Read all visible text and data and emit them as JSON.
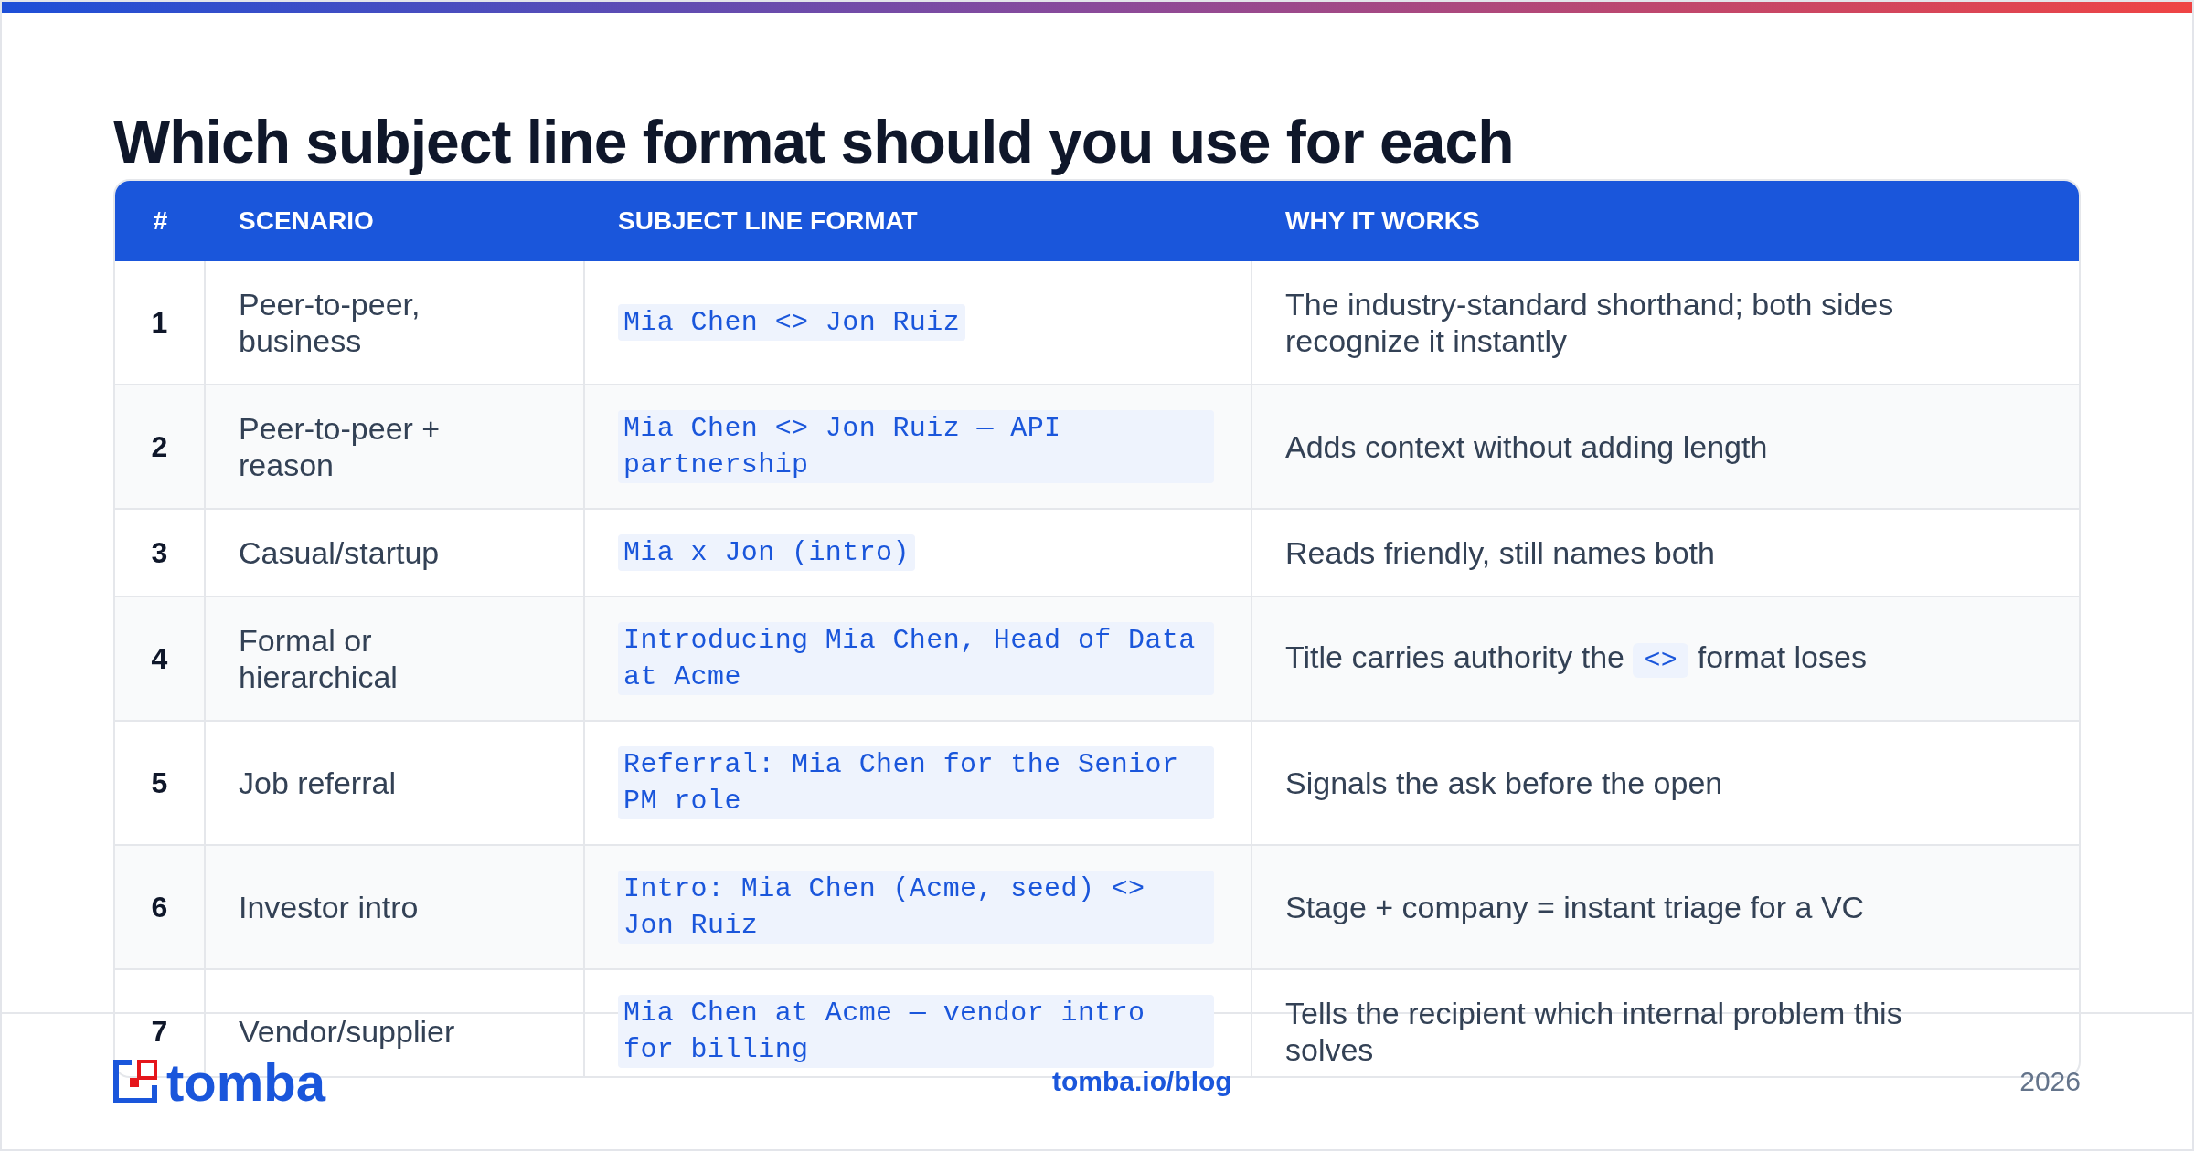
{
  "title": "Which subject line format should you use for each",
  "table": {
    "columns": [
      "#",
      "SCENARIO",
      "SUBJECT LINE FORMAT",
      "WHY IT WORKS"
    ],
    "rows": [
      {
        "number": "1",
        "scenario": "Peer-to-peer, business",
        "format": "Mia Chen <> Jon Ruiz",
        "why": [
          {
            "kind": "text",
            "text": "The industry-standard shorthand; both sides recognize it instantly"
          }
        ]
      },
      {
        "number": "2",
        "scenario": "Peer-to-peer + reason",
        "format": "Mia Chen <> Jon Ruiz — API partnership",
        "why": [
          {
            "kind": "text",
            "text": "Adds context without adding length"
          }
        ]
      },
      {
        "number": "3",
        "scenario": "Casual/startup",
        "format": "Mia x Jon (intro)",
        "why": [
          {
            "kind": "text",
            "text": "Reads friendly, still names both"
          }
        ]
      },
      {
        "number": "4",
        "scenario": "Formal or hierarchical",
        "format": "Introducing Mia Chen, Head of Data at Acme",
        "why": [
          {
            "kind": "text",
            "text": "Title carries authority the"
          },
          {
            "kind": "code",
            "text": "<>"
          },
          {
            "kind": "text",
            "text": "format loses"
          }
        ]
      },
      {
        "number": "5",
        "scenario": "Job referral",
        "format": "Referral: Mia Chen for the Senior PM role",
        "why": [
          {
            "kind": "text",
            "text": "Signals the ask before the open"
          }
        ]
      },
      {
        "number": "6",
        "scenario": "Investor intro",
        "format": "Intro: Mia Chen (Acme, seed) <> Jon Ruiz",
        "why": [
          {
            "kind": "text",
            "text": "Stage + company = instant triage for a VC"
          }
        ]
      },
      {
        "number": "7",
        "scenario": "Vendor/supplier",
        "format": "Mia Chen at Acme — vendor intro for billing",
        "why": [
          {
            "kind": "text",
            "text": "Tells the recipient which internal problem this solves"
          }
        ]
      }
    ]
  },
  "footer": {
    "logo": "tomba",
    "link": "tomba.io/blog",
    "year": "2026"
  }
}
